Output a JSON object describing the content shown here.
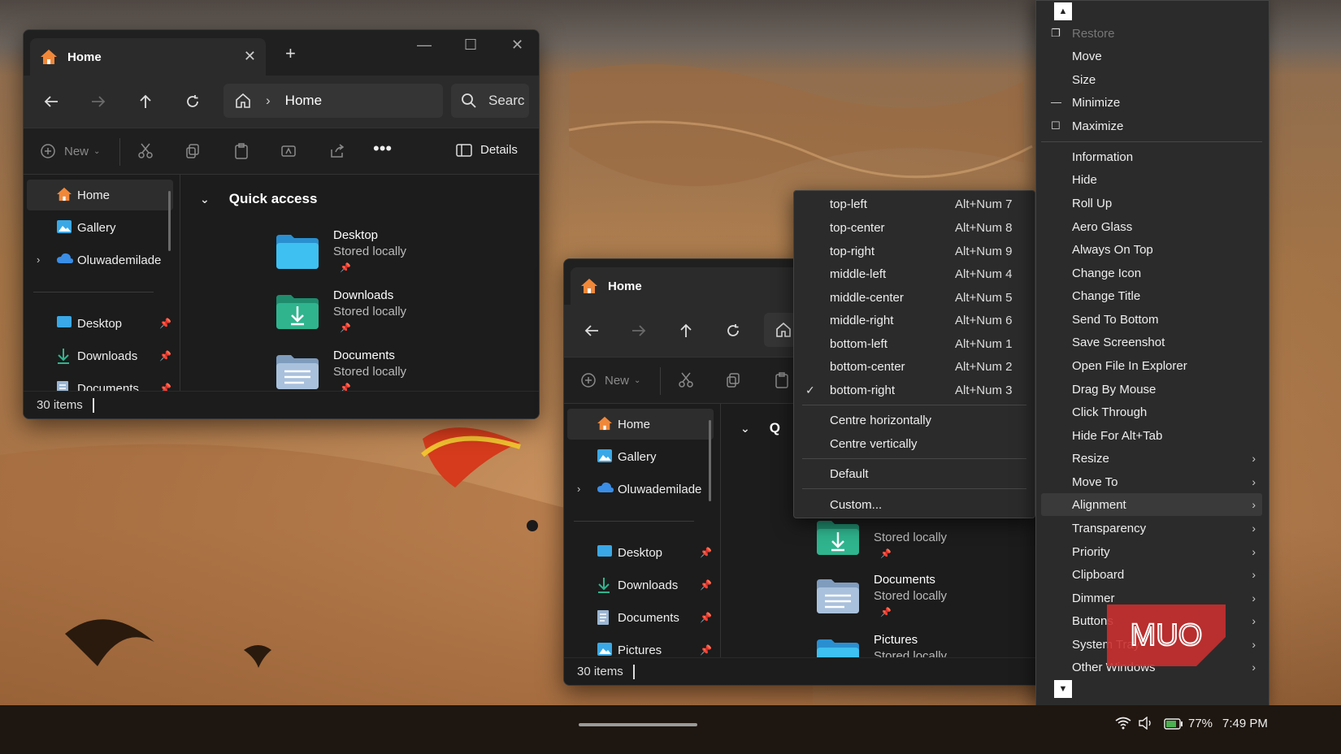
{
  "colors": {
    "accent_blue": "#4aa3df",
    "folder_blue": "#3aa8e6",
    "folder_green": "#2fb48e",
    "home_orange": "#f0883a",
    "watermark_red": "#c92f2f"
  },
  "window_back": {
    "tab_title": "Home",
    "address": "Home",
    "search_placeholder": "Searc",
    "toolbar": {
      "new_label": "New",
      "details_label": "Details"
    },
    "nav": {
      "home": "Home",
      "gallery": "Gallery",
      "onedrive": "Oluwademilade",
      "desktop": "Desktop",
      "downloads": "Downloads",
      "documents": "Documents"
    },
    "quick_access_title": "Quick access",
    "files": [
      {
        "name": "Desktop",
        "status": "Stored locally"
      },
      {
        "name": "Downloads",
        "status": "Stored locally"
      },
      {
        "name": "Documents",
        "status": "Stored locally"
      }
    ],
    "status_text": "30 items"
  },
  "window_front": {
    "tab_title": "Home",
    "quick_access_title": "Q",
    "toolbar": {
      "new_label": "New"
    },
    "nav": {
      "home": "Home",
      "gallery": "Gallery",
      "onedrive": "Oluwademilade",
      "desktop": "Desktop",
      "downloads": "Downloads",
      "documents": "Documents",
      "pictures": "Pictures"
    },
    "files": [
      {
        "name": "",
        "status": "Stored locally"
      },
      {
        "name": "Documents",
        "status": "Stored locally"
      },
      {
        "name": "Pictures",
        "status": "Stored locally"
      }
    ],
    "status_text": "30 items"
  },
  "alignment_menu": {
    "positions": [
      {
        "label": "top-left",
        "shortcut": "Alt+Num 7",
        "checked": false
      },
      {
        "label": "top-center",
        "shortcut": "Alt+Num 8",
        "checked": false
      },
      {
        "label": "top-right",
        "shortcut": "Alt+Num 9",
        "checked": false
      },
      {
        "label": "middle-left",
        "shortcut": "Alt+Num 4",
        "checked": false
      },
      {
        "label": "middle-center",
        "shortcut": "Alt+Num 5",
        "checked": false
      },
      {
        "label": "middle-right",
        "shortcut": "Alt+Num 6",
        "checked": false
      },
      {
        "label": "bottom-left",
        "shortcut": "Alt+Num 1",
        "checked": false
      },
      {
        "label": "bottom-center",
        "shortcut": "Alt+Num 2",
        "checked": false
      },
      {
        "label": "bottom-right",
        "shortcut": "Alt+Num 3",
        "checked": true
      }
    ],
    "centre_h": "Centre horizontally",
    "centre_v": "Centre vertically",
    "default": "Default",
    "custom": "Custom..."
  },
  "system_menu": {
    "restore": "Restore",
    "move": "Move",
    "size": "Size",
    "minimize": "Minimize",
    "maximize": "Maximize",
    "items": [
      "Information",
      "Hide",
      "Roll Up",
      "Aero Glass",
      "Always On Top",
      "Change Icon",
      "Change Title",
      "Send To Bottom",
      "Save Screenshot",
      "Open File In Explorer",
      "Drag By Mouse",
      "Click Through",
      "Hide For Alt+Tab"
    ],
    "submenus": [
      "Resize",
      "Move To",
      "Alignment",
      "Transparency",
      "Priority",
      "Clipboard",
      "Dimmer",
      "Buttons",
      "System Tray",
      "Other Windows"
    ],
    "highlighted": "Alignment"
  },
  "watermark_text": "MUO",
  "taskbar": {
    "battery": "77%",
    "time": "7:49 PM"
  }
}
